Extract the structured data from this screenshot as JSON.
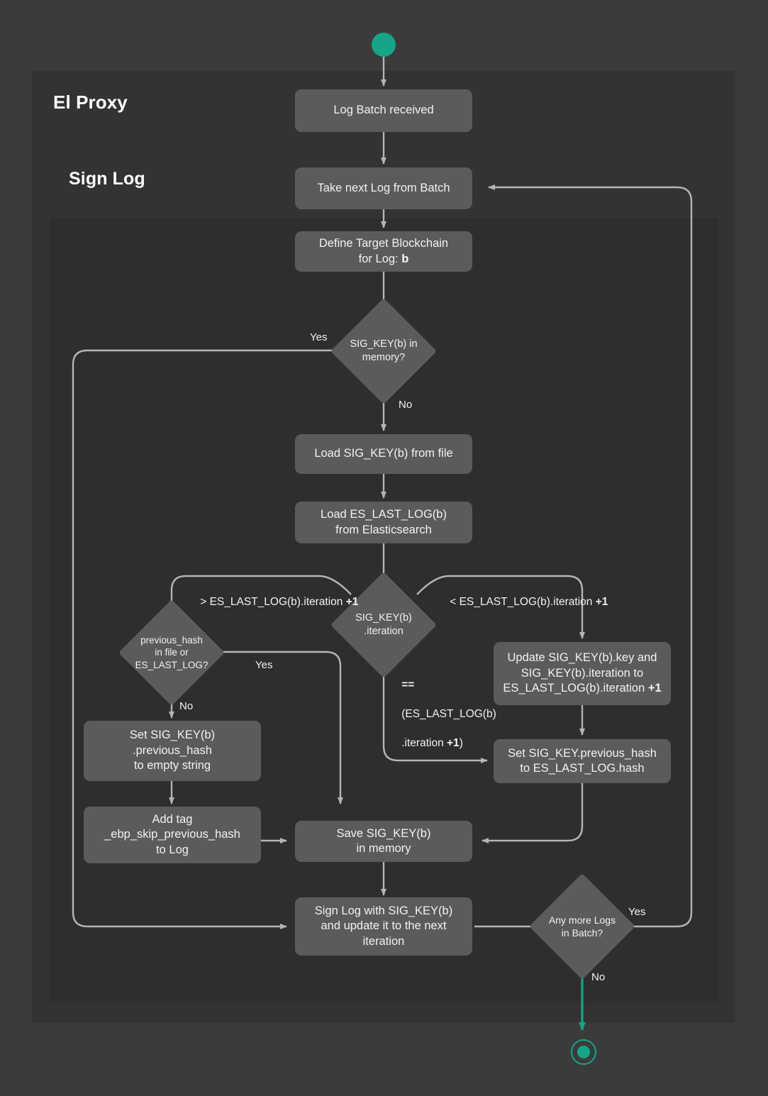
{
  "diagram": {
    "title": "El Proxy Sign Log flowchart",
    "type": "flowchart",
    "colors": {
      "page_background": "#3b3b3b",
      "lane_outer": "#333333",
      "lane_inner": "#2e2e2e",
      "node_fill": "#5b5b5b",
      "node_text": "#f2f2f2",
      "edge_stroke": "#b5b5b5",
      "terminator_accent": "#17a589"
    }
  },
  "lanes": [
    {
      "id": "el-proxy",
      "label": "El Proxy"
    },
    {
      "id": "sign-log",
      "label": "Sign Log"
    }
  ],
  "terminators": {
    "start": {
      "name": "start-node",
      "shape": "filled-circle"
    },
    "end": {
      "name": "end-node",
      "shape": "ring-circle"
    }
  },
  "nodes": [
    {
      "id": "log-batch-received",
      "type": "process",
      "text": "Log Batch received"
    },
    {
      "id": "take-next-log",
      "type": "process",
      "text": "Take next Log from Batch"
    },
    {
      "id": "define-target-blockchain",
      "type": "process",
      "line1": "Define Target Blockchain",
      "line2": "for Log: ",
      "bold2": "b"
    },
    {
      "id": "sig-key-in-memory",
      "type": "decision",
      "line1": "SIG_KEY(b) in",
      "line2": "memory?"
    },
    {
      "id": "load-sig-key",
      "type": "process",
      "text": "Load SIG_KEY(b) from file"
    },
    {
      "id": "load-es-last-log",
      "type": "process",
      "line1": "Load ES_LAST_LOG(b)",
      "line2": "from Elasticsearch"
    },
    {
      "id": "sig-key-iteration",
      "type": "decision",
      "line1": "SIG_KEY(b)",
      "line2": ".iteration"
    },
    {
      "id": "previous-hash-check",
      "type": "decision",
      "line1": "previous_hash",
      "line2": "in file or",
      "line3": "ES_LAST_LOG?"
    },
    {
      "id": "update-sig-key",
      "type": "process",
      "line1": "Update SIG_KEY(b).key and",
      "line2": "SIG_KEY(b).iteration to",
      "line3": "ES_LAST_LOG(b).iteration ",
      "bold3": "+1"
    },
    {
      "id": "set-previous-hash-empty",
      "type": "process",
      "line1": "Set SIG_KEY(b)",
      "line2": ".previous_hash",
      "line3": "to empty string"
    },
    {
      "id": "set-previous-hash-eslast",
      "type": "process",
      "line1": "Set SIG_KEY.previous_hash",
      "line2": "to ES_LAST_LOG.hash"
    },
    {
      "id": "add-tag",
      "type": "process",
      "line1": "Add tag",
      "line2": "_ebp_skip_previous_hash",
      "line3": "to Log"
    },
    {
      "id": "save-sig-key",
      "type": "process",
      "line1": "Save SIG_KEY(b)",
      "line2": "in memory"
    },
    {
      "id": "sign-log",
      "type": "process",
      "line1": "Sign Log with SIG_KEY(b)",
      "line2": "and update it to the next",
      "line3": "iteration"
    },
    {
      "id": "any-more-logs",
      "type": "decision",
      "line1": "Any more Logs",
      "line2": "in Batch?"
    }
  ],
  "edge_labels": {
    "memory_yes": "Yes",
    "memory_no": "No",
    "iteration_greater": "> ES_LAST_LOG(b).iteration ",
    "iteration_greater_bold": "+1",
    "iteration_less": "< ES_LAST_LOG(b).iteration ",
    "iteration_less_bold": "+1",
    "iteration_equal_l1": "==",
    "iteration_equal_l2": "(ES_LAST_LOG(b)",
    "iteration_equal_l3": ".iteration ",
    "iteration_equal_l3_bold": "+1",
    "iteration_equal_l3_tail": ")",
    "previous_hash_yes": "Yes",
    "previous_hash_no": "No",
    "more_logs_yes": "Yes",
    "more_logs_no": "No"
  }
}
